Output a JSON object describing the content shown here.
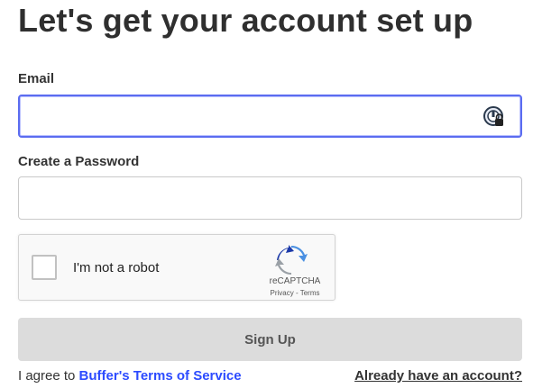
{
  "page": {
    "title": "Let's get your account set up"
  },
  "email": {
    "label": "Email",
    "value": "",
    "placeholder": ""
  },
  "password": {
    "label": "Create a Password",
    "value": "",
    "placeholder": ""
  },
  "captcha": {
    "checkbox_label": "I'm not a robot",
    "brand": "reCAPTCHA",
    "privacy_label": "Privacy",
    "separator": " - ",
    "terms_label": "Terms"
  },
  "signup_button": {
    "label": "Sign Up"
  },
  "footer": {
    "agree_text": "I agree to ",
    "terms_link": "Buffer's Terms of Service",
    "login_link": "Already have an account?"
  },
  "colors": {
    "accent_focus": "#5b6cf0",
    "link": "#2c4bff",
    "button_disabled": "#dcdcdc"
  },
  "icons": {
    "password_manager": "password-manager-icon",
    "recaptcha": "recaptcha-logo-icon"
  }
}
